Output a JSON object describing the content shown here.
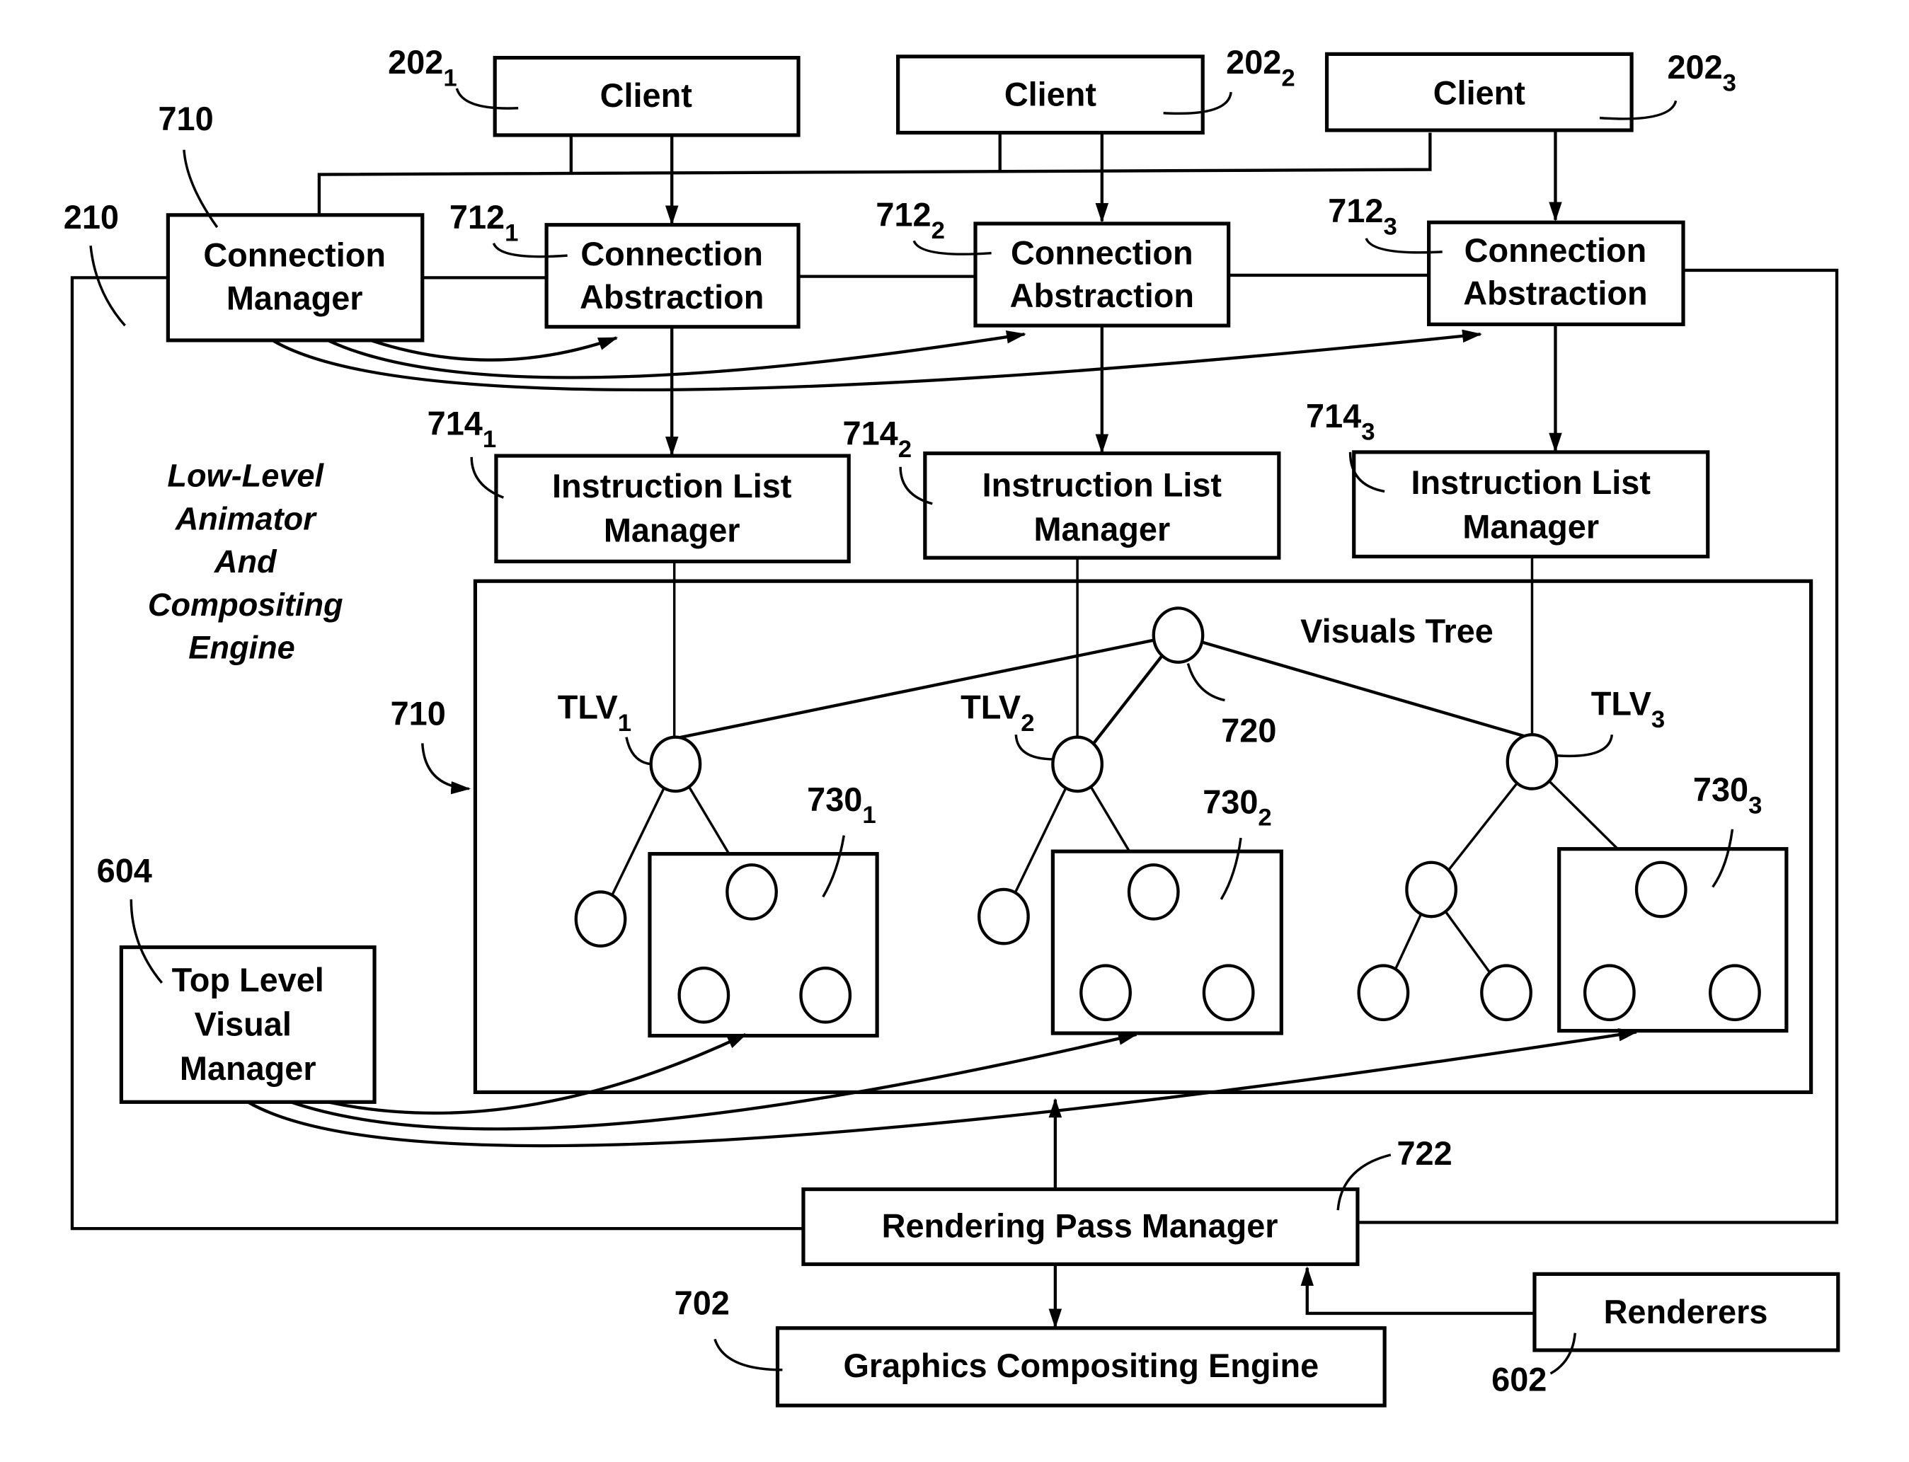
{
  "clients": [
    {
      "label": "Client",
      "ref": "202",
      "sub": "1"
    },
    {
      "label": "Client",
      "ref": "202",
      "sub": "2"
    },
    {
      "label": "Client",
      "ref": "202",
      "sub": "3"
    }
  ],
  "connection_manager": {
    "line1": "Connection",
    "line2": "Manager",
    "ref": "710"
  },
  "engine_ref": "210",
  "connection_abstractions": [
    {
      "line1": "Connection",
      "line2": "Abstraction",
      "ref": "712",
      "sub": "1"
    },
    {
      "line1": "Connection",
      "line2": "Abstraction",
      "ref": "712",
      "sub": "2"
    },
    {
      "line1": "Connection",
      "line2": "Abstraction",
      "ref": "712",
      "sub": "3"
    }
  ],
  "instruction_list_managers": [
    {
      "line1": "Instruction List",
      "line2": "Manager",
      "ref": "714",
      "sub": "1"
    },
    {
      "line1": "Instruction List",
      "line2": "Manager",
      "ref": "714",
      "sub": "2"
    },
    {
      "line1": "Instruction List",
      "line2": "Manager",
      "ref": "714",
      "sub": "3"
    }
  ],
  "engine_label": [
    "Low-Level",
    "Animator",
    "And",
    "Compositing",
    "Engine"
  ],
  "visuals_tree": {
    "title": "Visuals Tree",
    "ref": "710",
    "root_ref": "720",
    "tlvs": [
      {
        "label": "TLV",
        "sub": "1",
        "subtree_ref": "730",
        "subtree_sub": "1"
      },
      {
        "label": "TLV",
        "sub": "2",
        "subtree_ref": "730",
        "subtree_sub": "2"
      },
      {
        "label": "TLV",
        "sub": "3",
        "subtree_ref": "730",
        "subtree_sub": "3"
      }
    ]
  },
  "top_level_visual_manager": {
    "lines": [
      "Top Level",
      "Visual",
      "Manager"
    ],
    "ref": "604"
  },
  "rendering_pass_manager": {
    "label": "Rendering Pass Manager",
    "ref": "722"
  },
  "graphics_compositing_engine": {
    "label": "Graphics Compositing Engine",
    "ref": "702"
  },
  "renderers": {
    "label": "Renderers",
    "ref": "602"
  }
}
